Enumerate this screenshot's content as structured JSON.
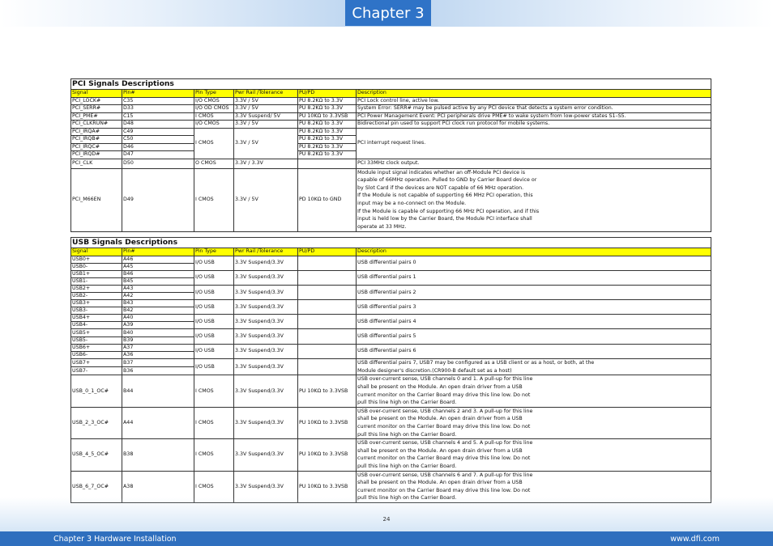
{
  "header": {
    "chapter_label": "Chapter 3"
  },
  "columns": [
    "Signal",
    "Pin#",
    "Pin Type",
    "Pwr Rail /Tolerance",
    "PU/PD",
    "Description"
  ],
  "pci": {
    "title": "PCI Signals Descriptions",
    "rows": [
      {
        "signal": "PCI_LOCK#",
        "pin": "C35",
        "type": "I/O CMOS",
        "rail": "3.3V / 5V",
        "pupd": "PU 8.2KΩ to 3.3V",
        "desc": "PCI Lock control line, active low."
      },
      {
        "signal": "PCI_SERR#",
        "pin": "D33",
        "type": "I/O OD CMOS",
        "rail": "3.3V / 5V",
        "pupd": "PU 8.2KΩ to 3.3V",
        "desc": "System Error: SERR# may be pulsed active by any PCI device that detects a system error condition."
      },
      {
        "signal": "PCI_PME#",
        "pin": "C15",
        "type": "I CMOS",
        "rail": "3.3V Suspend/ 5V",
        "pupd": "PU 10KΩ to 3.3VSB",
        "desc": "PCI Power Management Event: PCI peripherals drive PME# to wake system from low-power states S1–S5."
      },
      {
        "signal": "PCI_CLKRUN#",
        "pin": "D48",
        "type": "I/O CMOS",
        "rail": "3.3V / 5V",
        "pupd": "PU 8.2KΩ to 3.3V",
        "desc": "Bidirectional pin used to support PCI clock run protocol for mobile systems."
      }
    ],
    "irq_group": {
      "type": "I CMOS",
      "rail": "3.3V / 5V",
      "desc": "PCI interrupt request lines.",
      "rows": [
        {
          "signal": "PCI_IRQA#",
          "pin": "C49",
          "pupd": "PU 8.2KΩ to 3.3V"
        },
        {
          "signal": "PCI_IRQB#",
          "pin": "C50",
          "pupd": "PU 8.2KΩ to 3.3V"
        },
        {
          "signal": "PCI_IRQC#",
          "pin": "D46",
          "pupd": "PU 8.2KΩ to 3.3V"
        },
        {
          "signal": "PCI_IRQD#",
          "pin": "D47",
          "pupd": "PU 8.2KΩ to 3.3V"
        }
      ]
    },
    "clk": {
      "signal": "PCI_CLK",
      "pin": "D50",
      "type": "O CMOS",
      "rail": "3.3V / 3.3V",
      "pupd": "",
      "desc": "PCI 33MHz clock output."
    },
    "m66en": {
      "signal": "PCI_M66EN",
      "pin": "D49",
      "type": "I CMOS",
      "rail": "3.3V / 5V",
      "pupd": "PD 10KΩ to GND",
      "desc_lines": [
        "Module input signal indicates whether an off-Module PCI device is",
        "capable of 66MHz operation. Pulled to GND by Carrier Board device or",
        "by Slot Card if the devices are NOT capable of 66 MHz operation.",
        "If the Module is not capable of supporting 66 MHz PCI operation, this",
        "input may be a no-connect on the Module.",
        "If the Module is capable of supporting 66 MHz PCI operation, and if this",
        "input is held low by the Carrier Board, the Module PCI interface shall",
        "operate at 33 MHz."
      ]
    }
  },
  "usb": {
    "title": "USB Signals Descriptions",
    "pairs": [
      {
        "sig_p": "USB0+",
        "pin_p": "A46",
        "sig_n": "USB0-",
        "pin_n": "A45",
        "type": "I/O USB",
        "rail": "3.3V Suspend/3.3V",
        "desc": "USB differential pairs 0"
      },
      {
        "sig_p": "USB1+",
        "pin_p": "B46",
        "sig_n": "USB1-",
        "pin_n": "B45",
        "type": "I/O USB",
        "rail": "3.3V Suspend/3.3V",
        "desc": "USB differential pairs 1"
      },
      {
        "sig_p": "USB2+",
        "pin_p": "A43",
        "sig_n": "USB2-",
        "pin_n": "A42",
        "type": "I/O USB",
        "rail": "3.3V Suspend/3.3V",
        "desc": "USB differential pairs 2"
      },
      {
        "sig_p": "USB3+",
        "pin_p": "B43",
        "sig_n": "USB3-",
        "pin_n": "B42",
        "type": "I/O USB",
        "rail": "3.3V Suspend/3.3V",
        "desc": "USB differential pairs 3"
      },
      {
        "sig_p": "USB4+",
        "pin_p": "A40",
        "sig_n": "USB4-",
        "pin_n": "A39",
        "type": "I/O USB",
        "rail": "3.3V Suspend/3.3V",
        "desc": "USB differential pairs 4"
      },
      {
        "sig_p": "USB5+",
        "pin_p": "B40",
        "sig_n": "USB5-",
        "pin_n": "B39",
        "type": "I/O USB",
        "rail": "3.3V Suspend/3.3V",
        "desc": "USB differential pairs 5"
      },
      {
        "sig_p": "USB6+",
        "pin_p": "A37",
        "sig_n": "USB6-",
        "pin_n": "A36",
        "type": "I/O USB",
        "rail": "3.3V Suspend/3.3V",
        "desc": "USB differential pairs 6"
      }
    ],
    "pair7": {
      "sig_p": "USB7+",
      "pin_p": "B37",
      "sig_n": "USB7-",
      "pin_n": "B36",
      "type": "I/O USB",
      "rail": "3.3V Suspend/3.3V",
      "desc_lines": [
        "USB differential pairs 7, USB7 may be configured as a USB client or as a host, or both, at the",
        "Module designer's discretion.(CR900-B default set as a host)"
      ]
    },
    "oc_rows": [
      {
        "signal": "USB_0_1_OC#",
        "pin": "B44",
        "type": "I CMOS",
        "rail": "3.3V Suspend/3.3V",
        "pupd": "PU 10KΩ to 3.3VSB",
        "desc_lines": [
          "USB over-current sense, USB channels 0 and 1. A pull-up for this line",
          "shall be present on the Module. An open drain driver from a USB",
          "current monitor on the Carrier Board may drive this line low. Do not",
          "pull this line high on the Carrier Board."
        ]
      },
      {
        "signal": "USB_2_3_OC#",
        "pin": "A44",
        "type": "I CMOS",
        "rail": "3.3V Suspend/3.3V",
        "pupd": "PU 10KΩ to 3.3VSB",
        "desc_lines": [
          "USB over-current sense, USB channels 2 and 3. A pull-up for this line",
          "shall be present on the Module. An open drain driver from a USB",
          "current monitor on the Carrier Board may drive this line low. Do not",
          "pull this line high on the Carrier Board."
        ]
      },
      {
        "signal": "USB_4_5_OC#",
        "pin": "B38",
        "type": "I CMOS",
        "rail": "3.3V Suspend/3.3V",
        "pupd": "PU 10KΩ to 3.3VSB",
        "desc_lines": [
          "USB over-current sense, USB channels 4 and 5. A pull-up for this line",
          "shall be present on the Module. An open drain driver from a USB",
          "current monitor on the Carrier Board may drive this line low. Do not",
          "pull this line high on the Carrier Board."
        ]
      },
      {
        "signal": "USB_6_7_OC#",
        "pin": "A38",
        "type": "I CMOS",
        "rail": "3.3V Suspend/3.3V",
        "pupd": "PU 10KΩ to 3.3VSB",
        "desc_lines": [
          "USB over-current sense, USB channels 6 and 7. A pull-up for this line",
          "shall be present on the Module. An open drain driver from a USB",
          "current monitor on the Carrier Board may drive this line low. Do not",
          "pull this line high on the Carrier Board."
        ]
      }
    ]
  },
  "page_number": "24",
  "footer": {
    "left": "Chapter 3 Hardware Installation",
    "right": "www.dfi.com"
  },
  "colors": {
    "header_fill": "#ffff00",
    "chapter_tab": "#2f73c7",
    "footer_bar": "#2f6fbe"
  }
}
